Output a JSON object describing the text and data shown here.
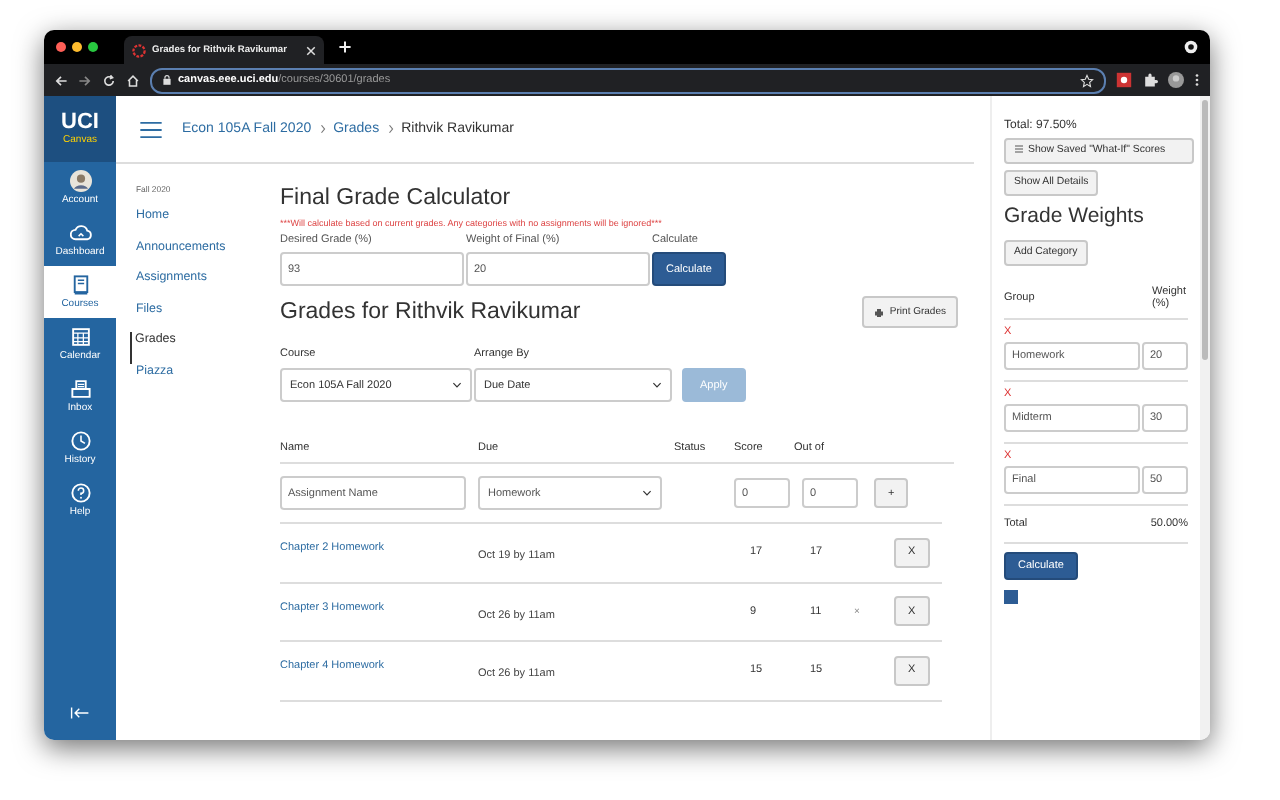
{
  "browser": {
    "tab_title": "Grades for Rithvik Ravikumar",
    "url_host": "canvas.eee.uci.edu",
    "url_path": "/courses/30601/grades"
  },
  "global_nav": {
    "logo": "UCI",
    "logo_sub": "Canvas",
    "items": [
      {
        "kind": "account",
        "label": "Account",
        "selected": false
      },
      {
        "kind": "dashboard",
        "label": "Dashboard",
        "selected": false
      },
      {
        "kind": "courses",
        "label": "Courses",
        "selected": true
      },
      {
        "kind": "calendar",
        "label": "Calendar",
        "selected": false
      },
      {
        "kind": "inbox",
        "label": "Inbox",
        "selected": false
      },
      {
        "kind": "history",
        "label": "History",
        "selected": false
      },
      {
        "kind": "help",
        "label": "Help",
        "selected": false
      }
    ]
  },
  "breadcrumb": [
    "Econ 105A Fall 2020",
    "Grades",
    "Rithvik Ravikumar"
  ],
  "course_nav": {
    "term": "Fall 2020",
    "items": [
      {
        "label": "Home",
        "selected": false
      },
      {
        "label": "Announcements",
        "selected": false
      },
      {
        "label": "Assignments",
        "selected": false
      },
      {
        "label": "Files",
        "selected": false
      },
      {
        "label": "Grades",
        "selected": true
      },
      {
        "label": "Piazza",
        "selected": false
      }
    ]
  },
  "calculator": {
    "title": "Final Grade Calculator",
    "note": "***Will calculate based on current grades. Any categories with no assignments will be ignored***",
    "fields": [
      {
        "label": "Desired Grade (%)",
        "value": "93"
      },
      {
        "label": "Weight of Final (%)",
        "value": "20"
      }
    ],
    "button_label": "Calculate",
    "button": "Calculate"
  },
  "grades": {
    "title": "Grades for Rithvik Ravikumar",
    "print_button": "Print Grades",
    "course": {
      "label": "Course",
      "value": "Econ 105A Fall 2020"
    },
    "arrange": {
      "label": "Arrange By",
      "value": "Due Date"
    },
    "apply": {
      "label": "Apply",
      "disabled": true
    },
    "columns": [
      "Name",
      "Due",
      "Status",
      "Score",
      "Out of"
    ],
    "new_row": {
      "placeholder": "Assignment Name",
      "group": "Homework",
      "score": "0",
      "out_of": "0",
      "add": "+"
    },
    "rows": [
      {
        "name": "Chapter 2 Homework",
        "due": "Oct 19 by 11am",
        "score": "17",
        "out_of": "17",
        "delete": "X"
      },
      {
        "name": "Chapter 3 Homework",
        "due": "Oct 26 by 11am",
        "score": "9",
        "out_of": "11",
        "flag": "×",
        "delete": "X"
      },
      {
        "name": "Chapter 4 Homework",
        "due": "Oct 26 by 11am",
        "score": "15",
        "out_of": "15",
        "delete": "X"
      }
    ]
  },
  "sidebar": {
    "total": "Total: 97.50%",
    "saved_button": "Show Saved \"What-If\" Scores",
    "details_button": "Show All Details",
    "weights_title": "Grade Weights",
    "add_button": "Add Category",
    "columns": [
      "Group",
      "Weight (%)"
    ],
    "groups": [
      {
        "remove": "X",
        "name": "Homework",
        "weight": "20"
      },
      {
        "remove": "X",
        "name": "Midterm",
        "weight": "30"
      },
      {
        "remove": "X",
        "name": "Final",
        "weight": "50"
      }
    ],
    "total_label": "Total",
    "total_value": "50.00%",
    "calculate": "Calculate",
    "checkbox": {
      "checked": true
    }
  }
}
